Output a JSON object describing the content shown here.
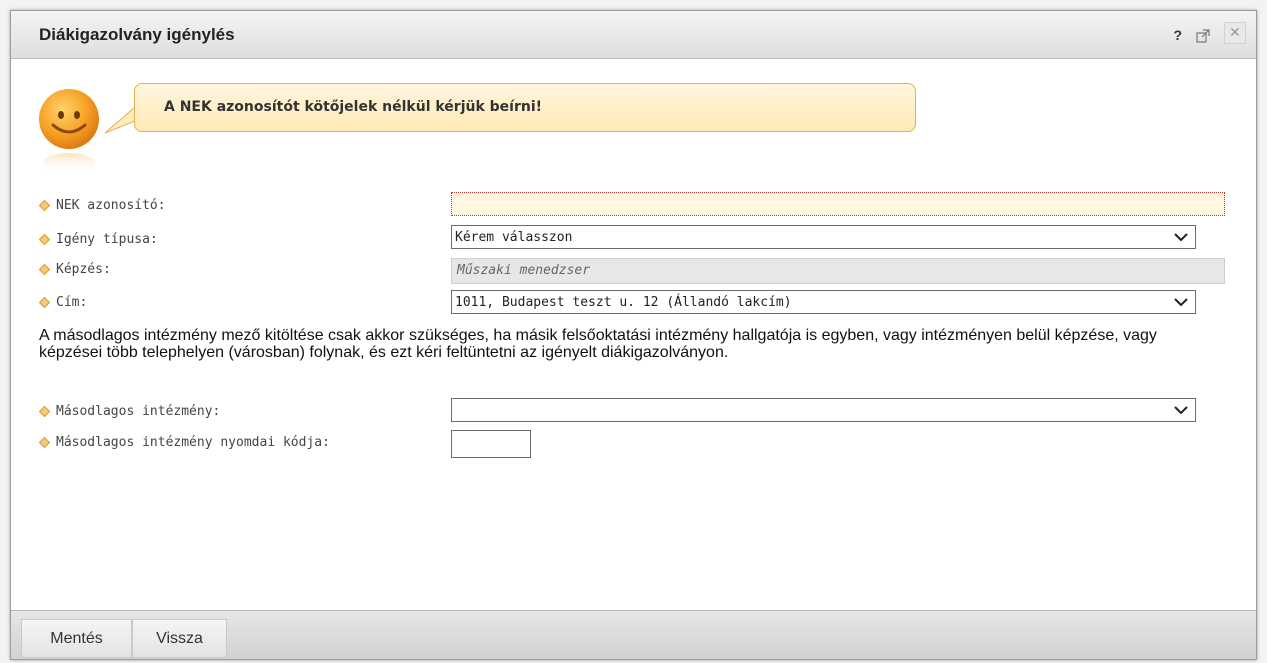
{
  "dialog": {
    "title": "Diákigazolvány igénylés",
    "help_label": "?",
    "close_label": "✕"
  },
  "notice": {
    "text": "A NEK azonosítót kötőjelek nélkül kérjük beírni!"
  },
  "form": {
    "nek": {
      "label": "NEK azonosító:",
      "value": ""
    },
    "igeny": {
      "label": "Igény típusa:",
      "value": "Kérem válasszon"
    },
    "kepzes": {
      "label": "Képzés:",
      "value": "Műszaki menedzser"
    },
    "cim": {
      "label": "Cím:",
      "value": "1011, Budapest teszt u. 12 (Állandó lakcím)"
    },
    "info": "A másodlagos intézmény mező kitöltése csak akkor szükséges, ha másik felsőoktatási intézmény hallgatója is egyben, vagy intézményen belül képzése, vagy képzései több telephelyen (városban) folynak, és ezt kéri feltüntetni az igényelt diákigazolványon.",
    "masodlagos": {
      "label": "Másodlagos intézmény:",
      "value": ""
    },
    "nyomdai": {
      "label": "Másodlagos intézmény nyomdai kódja:",
      "value": ""
    }
  },
  "footer": {
    "save_label": "Mentés",
    "back_label": "Vissza"
  },
  "colors": {
    "label_diamond": "#e0a64a",
    "required_border": "#c0392b",
    "notice_bg": "#ffe9b6",
    "notice_border": "#e3b24f"
  }
}
